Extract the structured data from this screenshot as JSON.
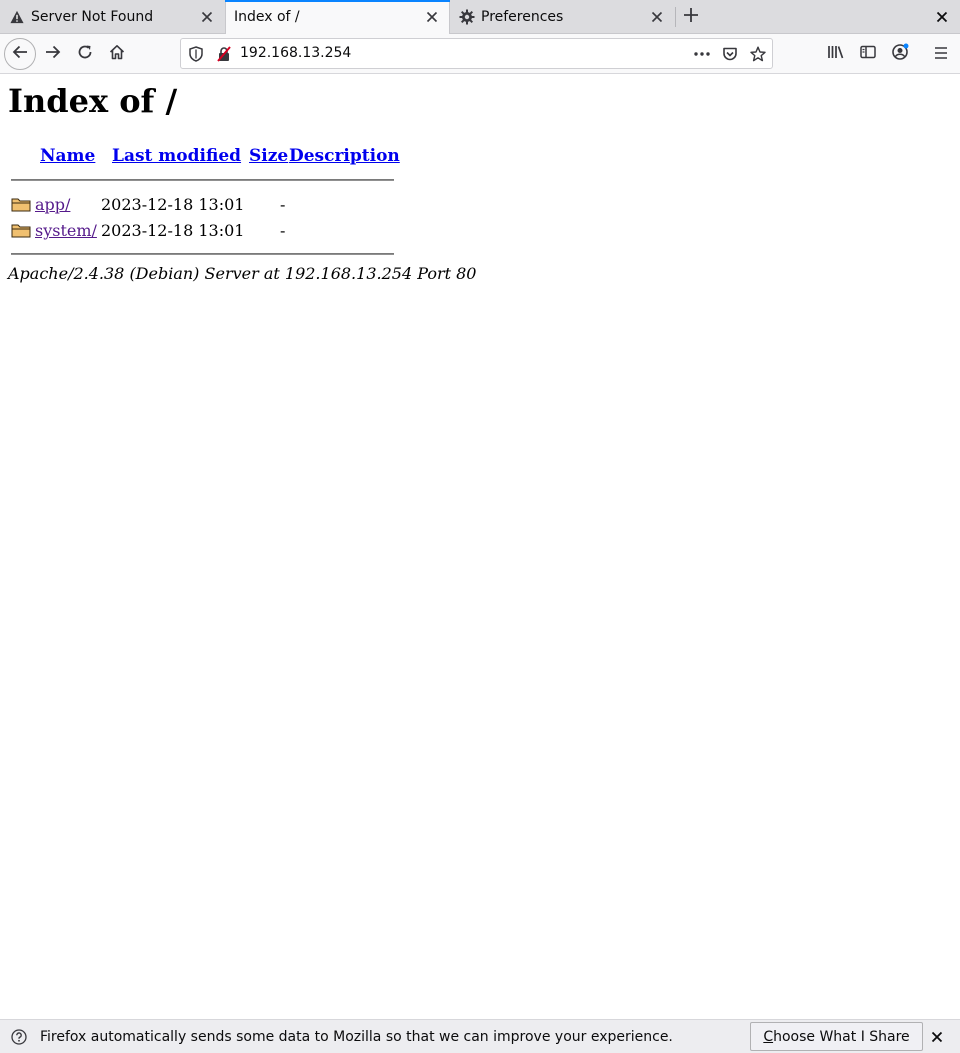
{
  "tabs": [
    {
      "label": "Server Not Found",
      "icon": "warning-icon",
      "active": false
    },
    {
      "label": "Index of /",
      "icon": "",
      "active": true
    },
    {
      "label": "Preferences",
      "icon": "gear-icon",
      "active": false
    }
  ],
  "navbar": {
    "url": "192.168.13.254"
  },
  "page": {
    "heading": "Index of /",
    "columns": {
      "name": "Name",
      "last_modified": "Last modified",
      "size": "Size",
      "description": "Description"
    },
    "entries": [
      {
        "name": "app/",
        "modified": "2023-12-18 13:01",
        "size": "-",
        "description": ""
      },
      {
        "name": "system/",
        "modified": "2023-12-18 13:01",
        "size": "-",
        "description": ""
      }
    ],
    "address": "Apache/2.4.38 (Debian) Server at 192.168.13.254 Port 80"
  },
  "notification": {
    "message": "Firefox automatically sends some data to Mozilla so that we can improve your experience.",
    "button_accesskey": "C",
    "button_rest": "hoose What I Share"
  },
  "colors": {
    "accent": "#0a84ff",
    "link": "#0000ee",
    "visited_link": "#551a8b"
  }
}
